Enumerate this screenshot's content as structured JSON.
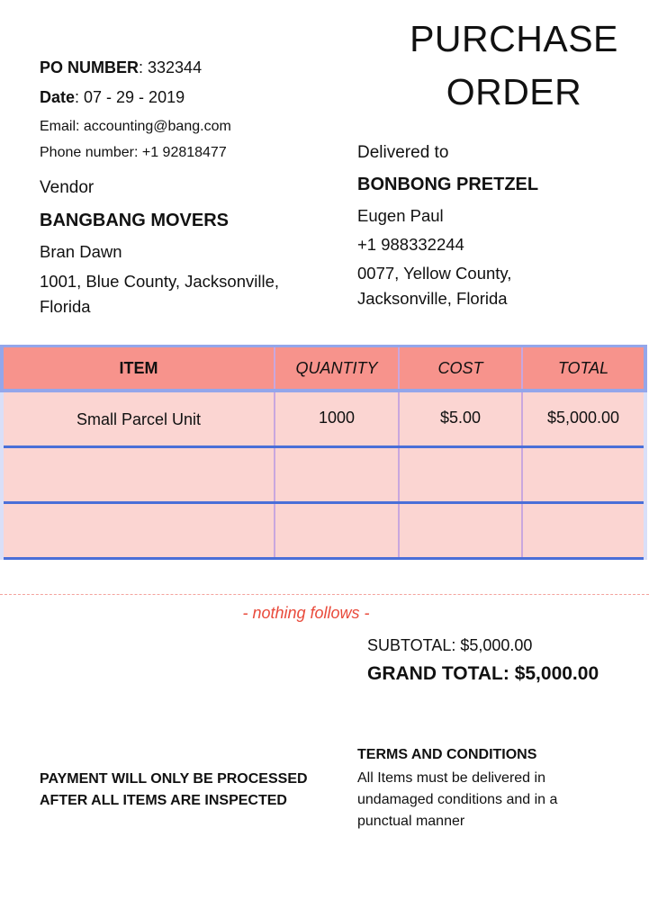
{
  "header": {
    "title_line1": "PURCHASE",
    "title_line2": "ORDER",
    "po_label": "PO NUMBER",
    "po_value": ": 332344",
    "date_label": "Date",
    "date_value": ": 07 - 29 - 2019",
    "email": "Email: accounting@bang.com",
    "phone": "Phone number: +1 92818477"
  },
  "vendor": {
    "label": "Vendor",
    "name": "BANGBANG MOVERS",
    "contact": "Bran Dawn",
    "address_line1": "1001, Blue County, Jacksonville,",
    "address_line2": "Florida"
  },
  "delivered_to": {
    "label": "Delivered to",
    "name": "BONBONG PRETZEL",
    "contact": "Eugen Paul",
    "phone": "+1 988332244",
    "address_line1": "0077, Yellow County,",
    "address_line2": "Jacksonville, Florida"
  },
  "table": {
    "headers": [
      "ITEM",
      "QUANTITY",
      "COST",
      "TOTAL"
    ],
    "rows": [
      [
        "Small Parcel Unit",
        "1000",
        "$5.00",
        "$5,000.00"
      ],
      [
        "",
        "",
        "",
        ""
      ],
      [
        "",
        "",
        "",
        ""
      ]
    ]
  },
  "nothing_follows": "- nothing follows -",
  "totals": {
    "subtotal": "SUBTOTAL: $5,000.00",
    "grand_total": "GRAND TOTAL: $5,000.00"
  },
  "payment_note": "PAYMENT WILL ONLY BE PROCESSED AFTER ALL ITEMS ARE INSPECTED",
  "terms": {
    "heading": "TERMS AND CONDITIONS",
    "text": "All Items must be delivered in undamaged conditions and in a punctual manner"
  },
  "colors": {
    "header_fill": "#f7938c",
    "row_fill": "#fbd5d2",
    "row_border": "#4a6fd8",
    "accent_red": "#e94b3c"
  }
}
